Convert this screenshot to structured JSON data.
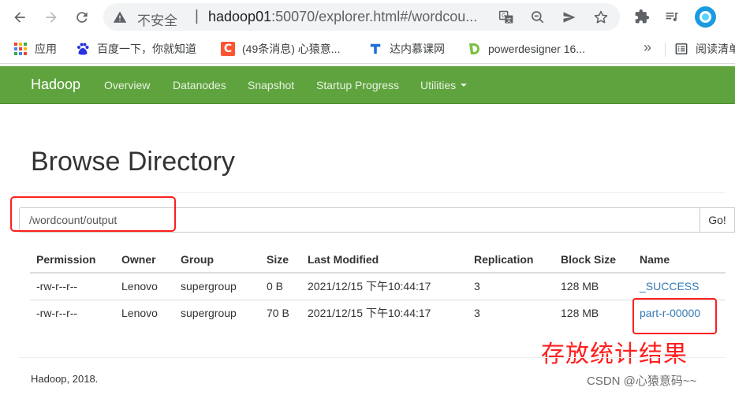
{
  "browser": {
    "insecure_label": "不安全",
    "separator": "|",
    "url_host": "hadoop01",
    "url_path": ":50070/explorer.html#/wordcou...",
    "profile_color": "#1a9be0"
  },
  "bookmarks": {
    "items": [
      {
        "label": "应用",
        "icon": "apps-grid-icon"
      },
      {
        "label": "百度一下，你就知道",
        "icon": "baidu-paw-icon"
      },
      {
        "label": "(49条消息) 心猿意...",
        "icon": "csdn-c-icon"
      },
      {
        "label": "达内慕课网",
        "icon": "tarena-icon"
      },
      {
        "label": "powerdesigner 16...",
        "icon": "powerdesigner-icon"
      }
    ],
    "more": "»",
    "reading_list": "阅读清单"
  },
  "navbar": {
    "brand": "Hadoop",
    "links": [
      "Overview",
      "Datanodes",
      "Snapshot",
      "Startup Progress",
      "Utilities"
    ],
    "bg_color": "#5fa33e"
  },
  "main": {
    "title": "Browse Directory",
    "path_value": "/wordcount/output",
    "go_label": "Go!",
    "columns": [
      "Permission",
      "Owner",
      "Group",
      "Size",
      "Last Modified",
      "Replication",
      "Block Size",
      "Name"
    ],
    "rows": [
      [
        "-rw-r--r--",
        "Lenovo",
        "supergroup",
        "0 B",
        "2021/12/15 下午10:44:17",
        "3",
        "128 MB",
        "_SUCCESS"
      ],
      [
        "-rw-r--r--",
        "Lenovo",
        "supergroup",
        "70 B",
        "2021/12/15 下午10:44:17",
        "3",
        "128 MB",
        "part-r-00000"
      ]
    ]
  },
  "annotation": {
    "text": "存放统计结果",
    "color": "#ff1f1f"
  },
  "footer": {
    "text": "Hadoop, 2018."
  },
  "watermark": {
    "text": "CSDN @心猿意码~~"
  }
}
